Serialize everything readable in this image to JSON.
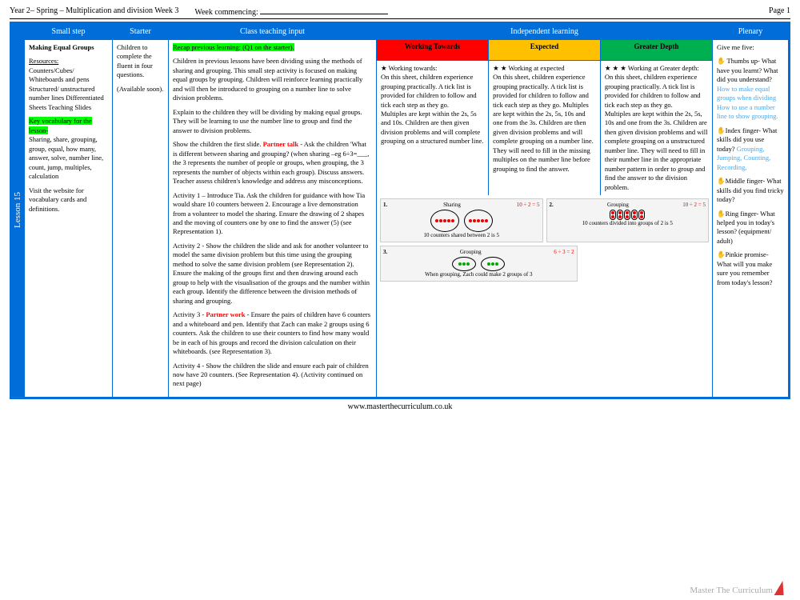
{
  "header": {
    "title": "Year 2– Spring – Multiplication and division Week  3",
    "week_label": "Week commencing:",
    "page": "Page 1"
  },
  "lesson_tab": "Lesson  15",
  "columns": {
    "small_step": "Small step",
    "starter": "Starter",
    "teaching": "Class teaching input",
    "independent": "Independent learning",
    "plenary": "Plenary"
  },
  "subcols": {
    "wt": "Working Towards",
    "ex": "Expected",
    "gd": "Greater Depth"
  },
  "small_step": {
    "title": "Making Equal Groups",
    "resources_label": "Resources:",
    "resources": "Counters/Cubes/ Whiteboards and pens Structured/ unstructured number lines Differentiated Sheets Teaching Slides",
    "kv_label": "Key vocabulary for the lesson-",
    "kv": "Sharing, share, grouping, group, equal, how many, answer, solve, number line, count, jump, multiples, calculation",
    "visit": "Visit the website for vocabulary cards and definitions."
  },
  "starter": {
    "p1": "Children to complete the fluent in four questions.",
    "p2": "(Available soon)."
  },
  "teaching": {
    "recap": "Recap previous learning: (Q1 on the starter).",
    "p1": "Children in previous lessons have been dividing using the methods of sharing and grouping. This small step activity is focused on making equal groups by grouping. Children will reinforce learning practically and will then be introduced to grouping on a number line to solve division problems.",
    "p2": "Explain to the children they will be dividing by making equal groups. They will be learning to use the number line to group and find the answer to division problems.",
    "p3a": "Show the children the first slide. ",
    "p3_partner": "Partner talk",
    "p3b": " - Ask the children 'What is different between sharing and grouping? (when sharing –eg 6÷3=___, the 3 represents the number of people or groups, when grouping, the 3 represents the number of objects within each group). Discuss answers. Teacher assess children's knowledge and address any misconceptions.",
    "a1": "Activity 1 – Introduce Tia. Ask the children for guidance with how Tia would share 10 counters between 2. Encourage a live demonstration from a volunteer to model the sharing. Ensure the drawing of 2 shapes and the moving of counters one by one to find the answer (5) (see Representation 1).",
    "a2": "Activity 2 - Show the children the slide and ask for another volunteer to model the same division problem but this time using the grouping method to solve the same division problem (see Representation 2). Ensure the making of the groups first and then drawing around each group to help with the visualisation of the groups and the number within each group. Identify the difference between the division methods of sharing and grouping.",
    "a3a": "Activity 3 - ",
    "a3_partner": "Partner work",
    "a3b": " - Ensure the pairs of children have 6 counters and a whiteboard and pen. Identify that Zach can make 2 groups using 6 counters. Ask the children to use their counters to find how many would be in each of his groups and record the division calculation on their whiteboards. (see Representation 3).",
    "a4": "Activity 4 - Show the children the slide and ensure each pair of children now have 20 counters. (See Representation 4). (Activity continued on next page)"
  },
  "indep": {
    "wt": "★  Working towards:\nOn this sheet, children experience grouping practically. A tick list is provided for children to follow and tick each step as they go.\nMultiples are kept within the 2s, 5s and 10s. Children are then given division problems and will complete grouping on a structured number line.",
    "ex": "★ ★  Working at expected\nOn this sheet, children experience grouping practically. A tick list is provided for children to follow and tick each step as they go. Multiples are kept within the 2s, 5s, 10s and one from the 3s. Children are then given division problems and will complete grouping on a number line.\nThey will need to fill in the missing multiples on the number line before grouping to find the answer.",
    "gd": "★ ★ ★ Working at Greater depth:\nOn this sheet, children experience grouping practically. A tick list is provided for children to follow and tick each step as they go.\nMultiples are kept within the 2s, 5s, 10s and one from the 3s. Children are then given division problems and will complete grouping on a unstructured number line. They will need to fill in their number line in the appropriate number pattern in order to group and find the answer to the division problem."
  },
  "reps": {
    "r1_title": "Sharing",
    "r1_eq": "10 ÷ 2 = 5",
    "r1_caption": "10 counters shared between 2 is 5",
    "r2_title": "Grouping",
    "r2_eq": "10 ÷ 2 = 5",
    "r2_caption": "10 counters divided into groups of 2 is 5",
    "r3_title": "Grouping",
    "r3_eq": "6 ÷ 3 = 2",
    "r3_caption": "When grouping, Zach could make 2 groups of 3"
  },
  "plenary": {
    "title": "Give me five:",
    "l1a": "✋ Thumbs up- What have you learnt? What did you understand?",
    "l1b": "How to make equal groups when dividing How to use a number line to show grouping.",
    "l2a": "✋Index finger- What skills did you use today?",
    "l2b": "Grouping, Jumping, Counting, Recording,",
    "l3": "✋Middle finger- What skills did you find tricky today?",
    "l4": "✋Ring finger- What helped you in today's lesson? (equipment/ adult)",
    "l5": "✋Pinkie promise- What will you make sure you remember from today's lesson?"
  },
  "footer": {
    "url": "www.masterthecurriculum.co.uk",
    "brand": "Master The Curriculum"
  }
}
